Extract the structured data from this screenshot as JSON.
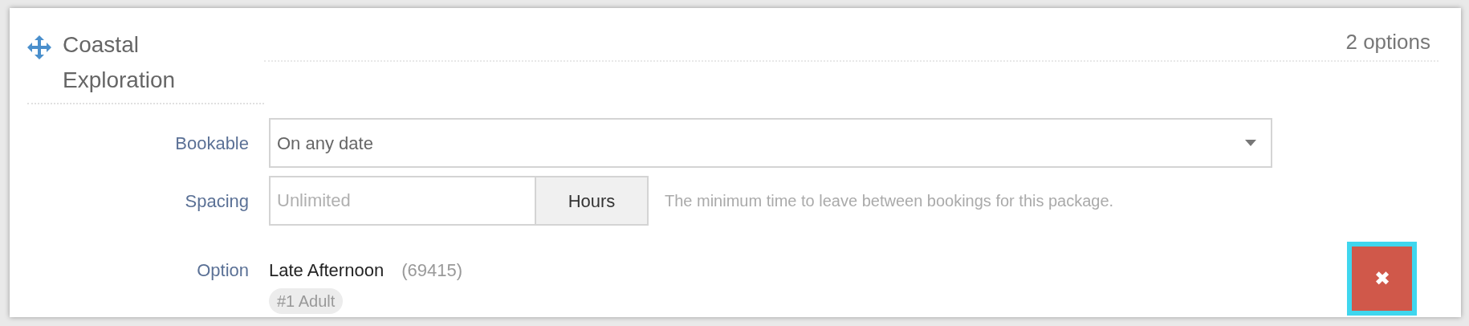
{
  "package": {
    "title": "Coastal Exploration",
    "options_count": "2 options"
  },
  "fields": [
    {
      "kind": "select",
      "label": "Bookable",
      "value": "On any date"
    },
    {
      "kind": "spacing",
      "label": "Spacing",
      "placeholder": "Unlimited",
      "unit": "Hours",
      "hint": "The minimum time to leave between bookings for this package."
    }
  ],
  "option": {
    "label": "Option",
    "name": "Late Afternoon",
    "code": "(69415)",
    "tags": [
      "#1 Adult"
    ]
  },
  "remove_button": {
    "symbol": "✖",
    "focused": true
  }
}
